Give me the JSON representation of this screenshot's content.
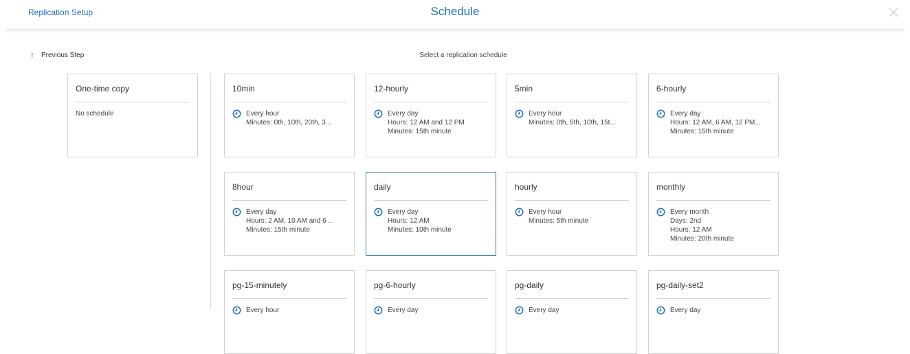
{
  "header": {
    "breadcrumb": "Replication Setup",
    "title": "Schedule"
  },
  "nav": {
    "previous_step": "Previous Step"
  },
  "main": {
    "subtitle": "Select a replication schedule"
  },
  "one_time": {
    "title": "One-time copy",
    "desc": "No schedule"
  },
  "schedules": [
    {
      "title": "10min",
      "lines": [
        "Every hour",
        "Minutes: 0th, 10th, 20th, 3..."
      ]
    },
    {
      "title": "12-hourly",
      "lines": [
        "Every day",
        "Hours: 12 AM and 12 PM",
        "Minutes: 15th minute"
      ]
    },
    {
      "title": "5min",
      "lines": [
        "Every hour",
        "Minutes: 0th, 5th, 10th, 15t..."
      ]
    },
    {
      "title": "6-hourly",
      "lines": [
        "Every day",
        "Hours: 12 AM, 6 AM, 12 PM...",
        "Minutes: 15th minute"
      ]
    },
    {
      "title": "8hour",
      "lines": [
        "Every day",
        "Hours: 2 AM, 10 AM and 6 ...",
        "Minutes: 15th minute"
      ]
    },
    {
      "title": "daily",
      "lines": [
        "Every day",
        "Hours: 12 AM",
        "Minutes: 10th minute"
      ],
      "selected": true
    },
    {
      "title": "hourly",
      "lines": [
        "Every hour",
        "Minutes: 5th minute"
      ]
    },
    {
      "title": "monthly",
      "lines": [
        "Every month",
        "Days: 2nd",
        "Hours: 12 AM",
        "Minutes: 20th minute"
      ]
    },
    {
      "title": "pg-15-minutely",
      "lines": [
        "Every hour"
      ]
    },
    {
      "title": "pg-6-hourly",
      "lines": [
        "Every day"
      ]
    },
    {
      "title": "pg-daily",
      "lines": [
        "Every day"
      ]
    },
    {
      "title": "pg-daily-set2",
      "lines": [
        "Every day"
      ]
    }
  ],
  "colors": {
    "accent": "#1f6fbf",
    "selected_border": "#3a79b8",
    "card_border": "#d3d3d3"
  }
}
